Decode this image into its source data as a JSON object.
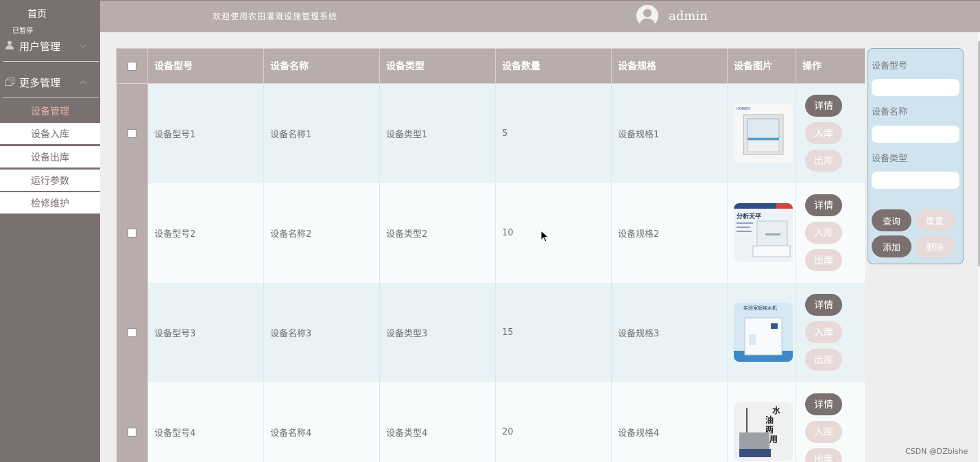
{
  "sidebar": {
    "home": "首页",
    "collapse": "已暂停",
    "menus": [
      {
        "label": "用户管理",
        "icon": "user-icon"
      },
      {
        "label": "更多管理",
        "icon": "copy-icon"
      }
    ],
    "sub_items": [
      {
        "label": "设备管理",
        "active": true
      },
      {
        "label": "设备入库",
        "active": false
      },
      {
        "label": "设备出库",
        "active": false
      },
      {
        "label": "运行参数",
        "active": false
      },
      {
        "label": "检修维护",
        "active": false
      }
    ]
  },
  "header": {
    "welcome": "欢迎使用农田灌溉设施管理系统",
    "username": "admin"
  },
  "table": {
    "columns": [
      "设备型号",
      "设备名称",
      "设备类型",
      "设备数量",
      "设备规格",
      "设备图片",
      "操作"
    ],
    "rows": [
      {
        "model": "设备型号1",
        "name": "设备名称1",
        "type": "设备类型1",
        "count": "5",
        "spec": "设备规格1",
        "image": "fume-hood",
        "image_text": [
          "HORIEN"
        ]
      },
      {
        "model": "设备型号2",
        "name": "设备名称2",
        "type": "设备类型2",
        "count": "10",
        "spec": "设备规格2",
        "image": "analytical-balance",
        "image_text": [
          "分析天平"
        ]
      },
      {
        "model": "设备型号3",
        "name": "设备名称3",
        "type": "设备类型3",
        "count": "15",
        "spec": "设备规格3",
        "image": "pure-water-machine",
        "image_text": [
          "实验室超纯水机"
        ]
      },
      {
        "model": "设备型号4",
        "name": "设备名称4",
        "type": "设备类型4",
        "count": "20",
        "spec": "设备规格4",
        "image": "water-bath",
        "image_text": [
          "水",
          "油",
          "两",
          "用"
        ]
      }
    ],
    "actions": {
      "detail": "详情",
      "stock_in": "入库",
      "stock_out": "出库"
    }
  },
  "search_panel": {
    "labels": [
      "设备型号",
      "设备名称",
      "设备类型"
    ],
    "buttons": {
      "query": "查询",
      "reset": "重置",
      "add": "添加",
      "delete": "删除"
    }
  },
  "watermark": "CSDN @DZbishe",
  "colors": {
    "sidebar": "#7a706f",
    "header": "#b8adab",
    "accent_pink": "#e3b2ab",
    "panel_bg": "#cfe4ee",
    "button_dark": "#7a706f",
    "button_light": "#e7d9d7"
  }
}
